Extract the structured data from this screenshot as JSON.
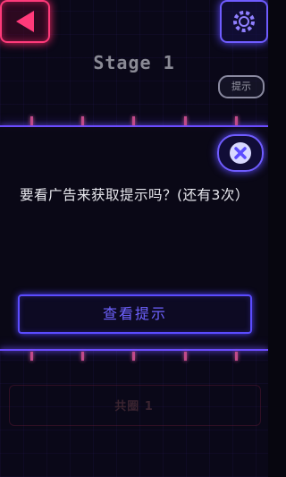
{
  "header": {
    "stage_title": "Stage 1",
    "hint_button_label": "提示"
  },
  "dialog": {
    "prompt": "要看广告来获取提示吗？(还有3次）",
    "watch_button_label": "查看提示"
  },
  "footer": {
    "dim_label": "共圈 1"
  },
  "colors": {
    "accent_purple": "#6b4cff",
    "back_red": "#ff3a7a",
    "tick_pink": "#c04a8a"
  },
  "icons": {
    "back": "back-arrow-icon",
    "settings": "gear-icon",
    "close": "close-icon"
  }
}
